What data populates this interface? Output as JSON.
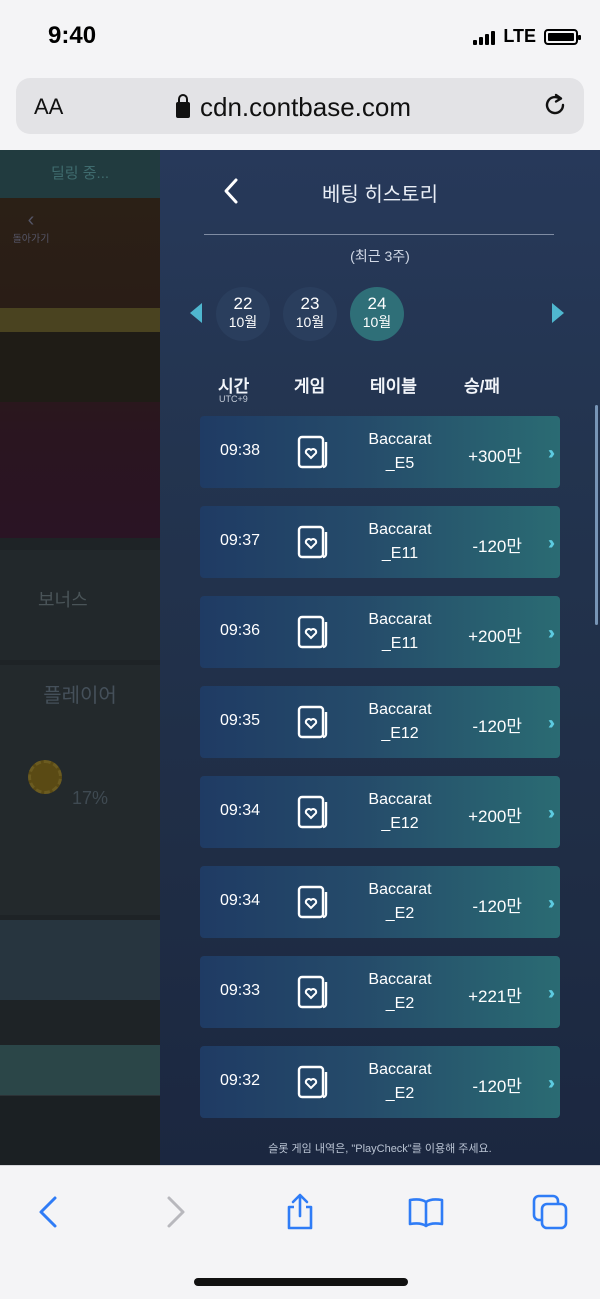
{
  "status_bar": {
    "time": "9:40",
    "network": "LTE"
  },
  "browser": {
    "aa_label": "AA",
    "url": "cdn.contbase.com"
  },
  "background": {
    "strip_label": "딜링 중...",
    "back_label": "돌아가기",
    "bonus_label": "보너스",
    "player_label": "플레이어",
    "percent": "17%"
  },
  "panel": {
    "title": "베팅 히스토리",
    "subtitle": "(최근 3주)",
    "dates": [
      {
        "day": "22",
        "month": "10월",
        "active": false
      },
      {
        "day": "23",
        "month": "10월",
        "active": false
      },
      {
        "day": "24",
        "month": "10월",
        "active": true
      }
    ],
    "columns": {
      "time": "시간",
      "time_sub": "UTC+9",
      "game": "게임",
      "table": "테이블",
      "result": "승/패"
    },
    "rows": [
      {
        "time": "09:38",
        "table_line1": "Baccarat",
        "table_line2": "_E5",
        "result": "+300만"
      },
      {
        "time": "09:37",
        "table_line1": "Baccarat",
        "table_line2": "_E11",
        "result": "-120만"
      },
      {
        "time": "09:36",
        "table_line1": "Baccarat",
        "table_line2": "_E11",
        "result": "+200만"
      },
      {
        "time": "09:35",
        "table_line1": "Baccarat",
        "table_line2": "_E12",
        "result": "-120만"
      },
      {
        "time": "09:34",
        "table_line1": "Baccarat",
        "table_line2": "_E12",
        "result": "+200만"
      },
      {
        "time": "09:34",
        "table_line1": "Baccarat",
        "table_line2": "_E2",
        "result": "-120만"
      },
      {
        "time": "09:33",
        "table_line1": "Baccarat",
        "table_line2": "_E2",
        "result": "+221만"
      },
      {
        "time": "09:32",
        "table_line1": "Baccarat",
        "table_line2": "_E2",
        "result": "-120만"
      }
    ],
    "footer": "슬롯 게임 내역은, \"PlayCheck\"를 이용해 주세요."
  },
  "icons": {
    "game": "card-heart-icon",
    "row_arrow": "double-chevron-right-icon"
  },
  "colors": {
    "accent": "#4fb7cf",
    "toolbar_blue": "#2f7cf6"
  }
}
